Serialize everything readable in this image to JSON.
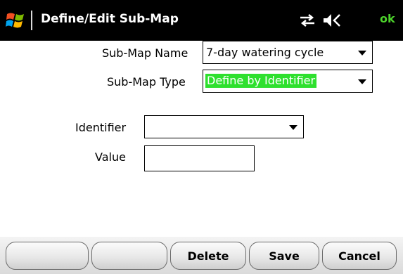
{
  "titlebar": {
    "title": "Define/Edit Sub-Map",
    "ok_label": "ok",
    "start_icon": "windows-flag-icon",
    "connectivity_icon": "connectivity-arrows-icon",
    "volume_icon": "volume-icon"
  },
  "form": {
    "submap_name": {
      "label": "Sub-Map Name",
      "value": "7-day watering cycle"
    },
    "submap_type": {
      "label": "Sub-Map Type",
      "value": "Define by Identifier"
    },
    "identifier": {
      "label": "Identifier",
      "value": ""
    },
    "value": {
      "label": "Value",
      "value": ""
    }
  },
  "softkeys": {
    "blank1": "",
    "blank2": "",
    "delete": "Delete",
    "save": "Save",
    "cancel": "Cancel"
  },
  "colors": {
    "titlebar_bg": "#000000",
    "ok_green": "#4cd12b",
    "selection_green": "#2ee02e"
  }
}
